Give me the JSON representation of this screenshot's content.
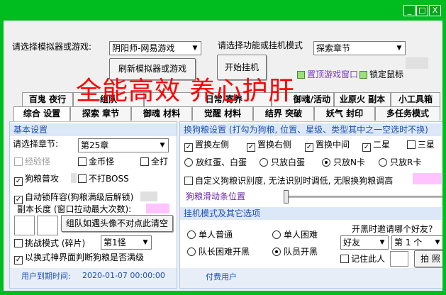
{
  "titlebar": {
    "minimize": "_",
    "restore": "□",
    "close": "X"
  },
  "top": {
    "emulator_label": "请选择模拟器或游戏:",
    "emulator_value": "阴阳师-网易游戏",
    "mode_label": "请选择功能或挂机模式",
    "mode_value": "探索章节",
    "refresh_btn": "刷新模拟器或游戏",
    "start_btn": "开始挂机",
    "pin_window": "置顶游戏窗口",
    "lock_mouse": "锁定鼠标"
  },
  "tabs_back": [
    "百鬼 夜行",
    "组队",
    "日常/寄养",
    "御魂/活动",
    "业原火 副本",
    "小工具箱"
  ],
  "tabs_front": [
    "综合 设置",
    "探索 章节",
    "御魂 材料",
    "觉醒 材料",
    "结界 突破",
    "妖气 封印",
    "多任务模式"
  ],
  "watermark": "全能高效 养心护肝",
  "left": {
    "basic_title": "基本设置",
    "chapter_label": "请选择章节:",
    "chapter_value": "第25章",
    "opt_exp": "经验怪",
    "opt_gold": "金币怪",
    "opt_all": "全打",
    "opt_fodder": "狗粮普攻",
    "opt_noboss": "不打BOSS",
    "opt_lock": "自动锁阵容(狗粮满级后解锁)",
    "copy_len": "副本长度 (窗口拉动最大次数):",
    "party_btn": "组队如遇头像不对点此清空",
    "challenge": "挑战模式 (碎片)",
    "challenge_value": "第1怪",
    "judge": "以换式神界面判断狗粮是否满级",
    "expire_label": "用户到期时间:",
    "expire_value": "2020-01-07 00:00:00"
  },
  "right": {
    "swap_title": "换狗粮设置 (打勾为狗粮, 位置、星级、类型其中之一空选时不换)",
    "pos_left": "置换左侧",
    "pos_right": "置换右侧",
    "pos_mid": "置换中间",
    "star2": "二星",
    "star3": "三星",
    "r_red_white": "放红蛋、白蛋",
    "r_white": "只放白蛋",
    "r_n": "只放N卡",
    "r_r": "只放R卡",
    "custom": "自定义狗粮识别度, 无法识别时调低, 无限换狗粮调高",
    "slider_label": "狗粮滑动条位置",
    "hang_title": "挂机模式及其它选项",
    "solo_normal": "单人普通",
    "solo_hard": "单人困难",
    "leader_hard": "队长困难开黑",
    "member": "队员开黑",
    "invite_label": "开黑时邀请哪个好友?",
    "friend_value": "好友",
    "num_value": "第 1 个",
    "remember": "记住此人",
    "shoot_btn": "拍 照",
    "paid_user": "付费用户"
  }
}
